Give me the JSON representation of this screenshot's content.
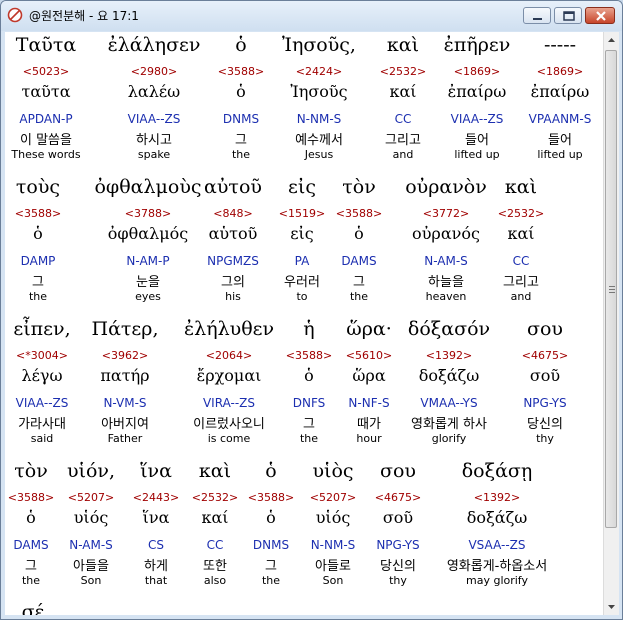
{
  "window": {
    "title": "@원전분해 - 요 17:1"
  },
  "verse": {
    "rows": [
      {
        "words": [
          {
            "greek": "Ταῦτα",
            "num": "<5023>",
            "lemma": "ταῦτα",
            "parse": "APDAN-P",
            "korean": "이 말씀을",
            "english": "These words"
          },
          {
            "greek": "ἐλάλησεν",
            "num": "<2980>",
            "lemma": "λαλέω",
            "parse": "VIAA--ZS",
            "korean": "하시고",
            "english": "spake"
          },
          {
            "greek": "ὁ",
            "num": "<3588>",
            "lemma": "ὁ",
            "parse": "DNMS",
            "korean": "그",
            "english": "the"
          },
          {
            "greek": "Ἰησοῦς,",
            "num": "<2424>",
            "lemma": "Ἰησοῦς",
            "parse": "N-NM-S",
            "korean": "예수께서",
            "english": "Jesus"
          },
          {
            "greek": "καὶ",
            "num": "<2532>",
            "lemma": "καί",
            "parse": "CC",
            "korean": "그리고",
            "english": "and"
          },
          {
            "greek": "ἐπῆρεν",
            "num": "<1869>",
            "lemma": "ἐπαίρω",
            "parse": "VIAA--ZS",
            "korean": "들어",
            "english": "lifted up"
          },
          {
            "greek": "-----",
            "num": "<1869>",
            "lemma": "ἐπαίρω",
            "parse": "VPAANM-S",
            "korean": "들어",
            "english": "lifted up"
          }
        ]
      },
      {
        "words": [
          {
            "greek": "τοὺς",
            "num": "<3588>",
            "lemma": "ὁ",
            "parse": "DAMP",
            "korean": "그",
            "english": "the"
          },
          {
            "greek": "ὀφθαλμοὺς",
            "num": "<3788>",
            "lemma": "ὀφθαλμός",
            "parse": "N-AM-P",
            "korean": "눈을",
            "english": "eyes"
          },
          {
            "greek": "αὐτοῦ",
            "num": "<848>",
            "lemma": "αὑτοῦ",
            "parse": "NPGMZS",
            "korean": "그의",
            "english": "his"
          },
          {
            "greek": "εἰς",
            "num": "<1519>",
            "lemma": "εἰς",
            "parse": "PA",
            "korean": "우러러",
            "english": "to"
          },
          {
            "greek": "τὸν",
            "num": "<3588>",
            "lemma": "ὁ",
            "parse": "DAMS",
            "korean": "그",
            "english": "the"
          },
          {
            "greek": "οὐρανὸν",
            "num": "<3772>",
            "lemma": "οὐρανός",
            "parse": "N-AM-S",
            "korean": "하늘을",
            "english": "heaven"
          },
          {
            "greek": "καὶ",
            "num": "<2532>",
            "lemma": "καί",
            "parse": "CC",
            "korean": "그리고",
            "english": "and"
          }
        ]
      },
      {
        "words": [
          {
            "greek": "εἶπεν,",
            "num": "<*3004>",
            "lemma": "λέγω",
            "parse": "VIAA--ZS",
            "korean": "가라사대",
            "english": "said"
          },
          {
            "greek": "Πάτερ,",
            "num": "<3962>",
            "lemma": "πατήρ",
            "parse": "N-VM-S",
            "korean": "아버지여",
            "english": "Father"
          },
          {
            "greek": "ἐλήλυθεν",
            "num": "<2064>",
            "lemma": "ἔρχομαι",
            "parse": "VIRA--ZS",
            "korean": "이르렀사오니",
            "english": "is come"
          },
          {
            "greek": "ἡ",
            "num": "<3588>",
            "lemma": "ὁ",
            "parse": "DNFS",
            "korean": "그",
            "english": "the"
          },
          {
            "greek": "ὥρα·",
            "num": "<5610>",
            "lemma": "ὥρα",
            "parse": "N-NF-S",
            "korean": "때가",
            "english": "hour"
          },
          {
            "greek": "δόξασόν",
            "num": "<1392>",
            "lemma": "δοξάζω",
            "parse": "VMAA--YS",
            "korean": "영화롭게 하사",
            "english": "glorify"
          },
          {
            "greek": "σου",
            "num": "<4675>",
            "lemma": "σοῦ",
            "parse": "NPG-YS",
            "korean": "당신의",
            "english": "thy"
          }
        ]
      },
      {
        "words": [
          {
            "greek": "τὸν",
            "num": "<3588>",
            "lemma": "ὁ",
            "parse": "DAMS",
            "korean": "그",
            "english": "the"
          },
          {
            "greek": "υἱόν,",
            "num": "<5207>",
            "lemma": "υἱός",
            "parse": "N-AM-S",
            "korean": "아들을",
            "english": "Son"
          },
          {
            "greek": "ἵνα",
            "num": "<2443>",
            "lemma": "ἵνα",
            "parse": "CS",
            "korean": "하게",
            "english": "that"
          },
          {
            "greek": "καὶ",
            "num": "<2532>",
            "lemma": "καί",
            "parse": "CC",
            "korean": "또한",
            "english": "also"
          },
          {
            "greek": "ὁ",
            "num": "<3588>",
            "lemma": "ὁ",
            "parse": "DNMS",
            "korean": "그",
            "english": "the"
          },
          {
            "greek": "υἱὸς",
            "num": "<5207>",
            "lemma": "υἱός",
            "parse": "N-NM-S",
            "korean": "아들로",
            "english": "Son"
          },
          {
            "greek": "σου",
            "num": "<4675>",
            "lemma": "σοῦ",
            "parse": "NPG-YS",
            "korean": "당신의",
            "english": "thy"
          },
          {
            "greek": "δοξάσῃ",
            "num": "<1392>",
            "lemma": "δοξάζω",
            "parse": "VSAA--ZS",
            "korean": "영화롭게-하옵소서",
            "english": "may glorify"
          }
        ]
      }
    ],
    "next_partial": "σέ"
  },
  "colors": {
    "strong": "#a00000",
    "parse": "#1c2fb0",
    "text": "#000000",
    "title_bg": "#dbe7f4"
  }
}
